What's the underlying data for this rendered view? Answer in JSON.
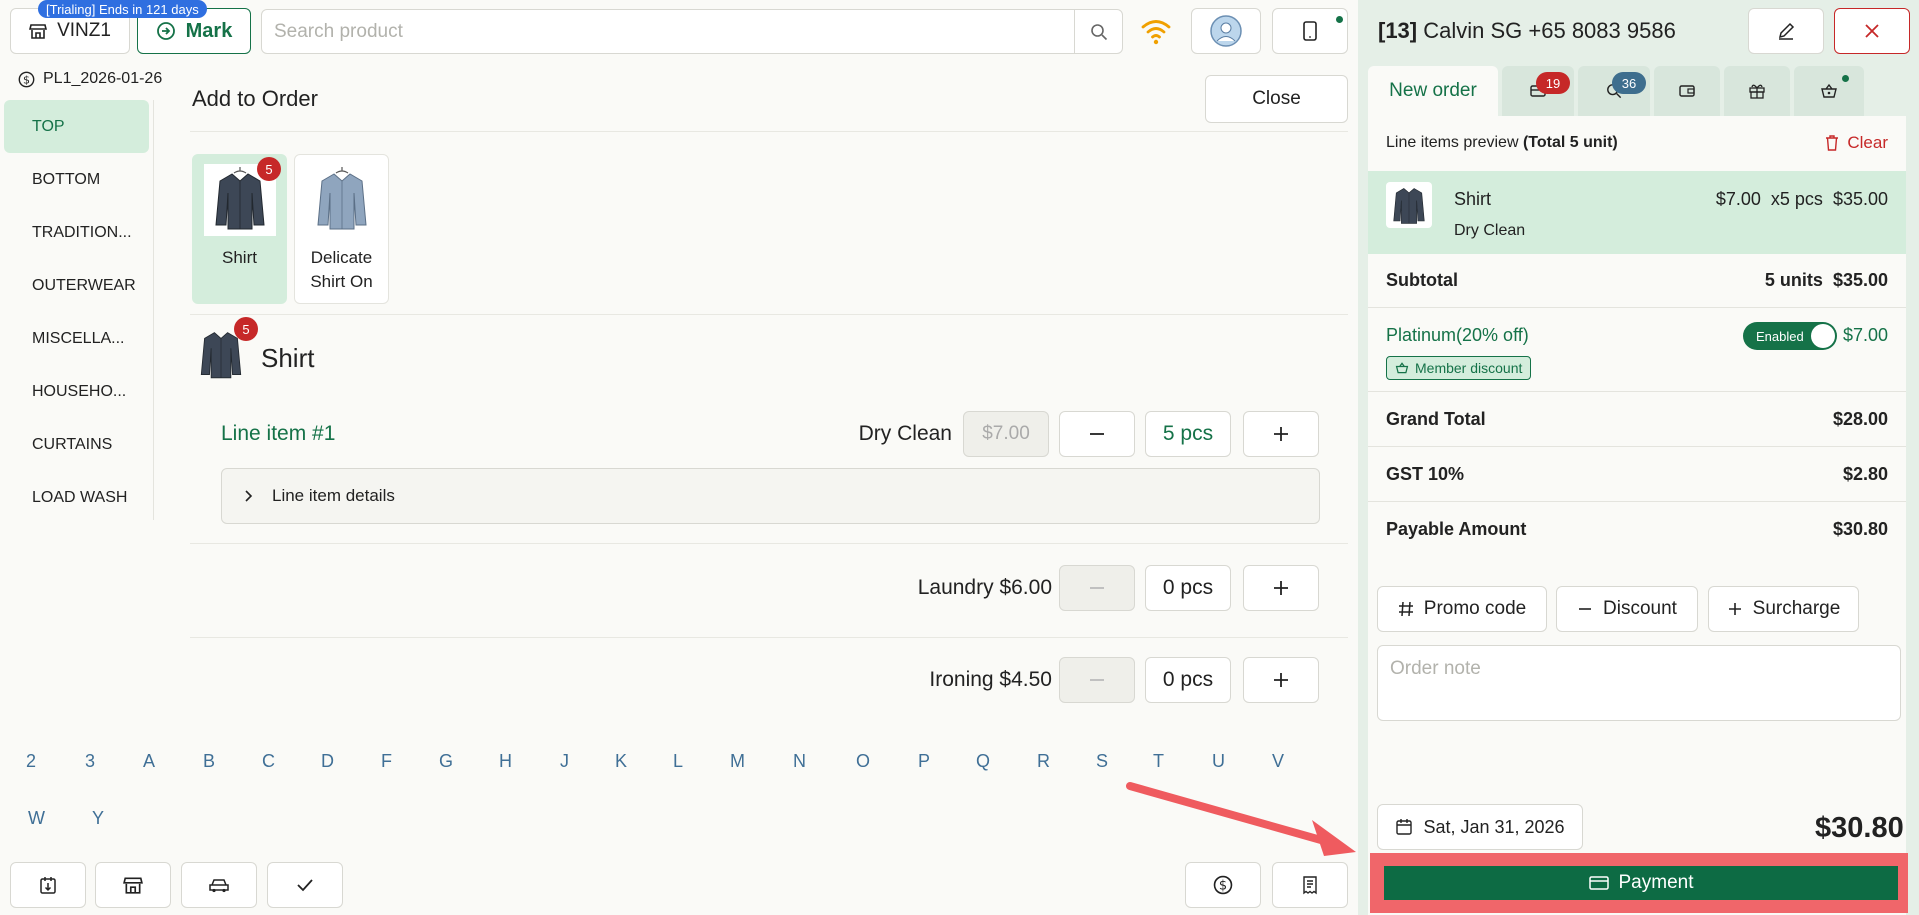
{
  "header": {
    "trial_badge": "[Trialing] Ends in 121 days",
    "store_name": "VINZ1",
    "mark_label": "Mark",
    "search_placeholder": "Search product"
  },
  "sidebar": {
    "pricelist": "PL1_2026-01-26",
    "categories": [
      "TOP",
      "BOTTOM",
      "TRADITION...",
      "OUTERWEAR",
      "MISCELLA...",
      "HOUSEHO...",
      "CURTAINS",
      "LOAD WASH"
    ]
  },
  "main": {
    "title": "Add to Order",
    "close_label": "Close",
    "products": [
      {
        "label": "Shirt",
        "badge": "5"
      },
      {
        "label": "Delicate Shirt On",
        "badge": ""
      }
    ],
    "detail": {
      "name": "Shirt",
      "badge": "5",
      "line_item_title": "Line item #1",
      "details_label": "Line item details",
      "services": [
        {
          "label": "Dry Clean",
          "price": "$7.00",
          "qty": "5 pcs"
        },
        {
          "label": "Laundry $6.00",
          "qty": "0 pcs"
        },
        {
          "label": "Ironing $4.50",
          "qty": "0 pcs"
        }
      ]
    },
    "alphabet": [
      "2",
      "3",
      "A",
      "B",
      "C",
      "D",
      "F",
      "G",
      "H",
      "J",
      "K",
      "L",
      "M",
      "N",
      "O",
      "P",
      "Q",
      "R",
      "S",
      "T",
      "U",
      "V",
      "W",
      "Y"
    ]
  },
  "order": {
    "customer_id": "[13]",
    "customer": "Calvin SG +65 8083 9586",
    "tabs": {
      "new_order": "New order",
      "bills_count": "19",
      "search_count": "36"
    },
    "preview_label": "Line items preview",
    "preview_total": "(Total 5 unit)",
    "clear_label": "Clear",
    "item": {
      "name": "Shirt",
      "service": "Dry Clean",
      "price": "$7.00",
      "qty": "x5 pcs",
      "total": "$35.00"
    },
    "subtotal_label": "Subtotal",
    "subtotal_units": "5 units",
    "subtotal_value": "$35.00",
    "platinum_label": "Platinum(20% off)",
    "toggle_label": "Enabled",
    "platinum_value": "$7.00",
    "member_tag": "Member discount",
    "grand_total_label": "Grand Total",
    "grand_total_value": "$28.00",
    "gst_label": "GST 10%",
    "gst_value": "$2.80",
    "payable_label": "Payable Amount",
    "payable_value": "$30.80",
    "promo_label": "Promo code",
    "discount_label": "Discount",
    "surcharge_label": "Surcharge",
    "note_placeholder": "Order note",
    "date": "Sat, Jan 31, 2026",
    "grand_display": "$30.80",
    "payment_label": "Payment"
  },
  "colors": {
    "brand": "#157248",
    "danger": "#c62828",
    "accent_blue": "#2f6fe0",
    "highlight": "#f0666a"
  }
}
